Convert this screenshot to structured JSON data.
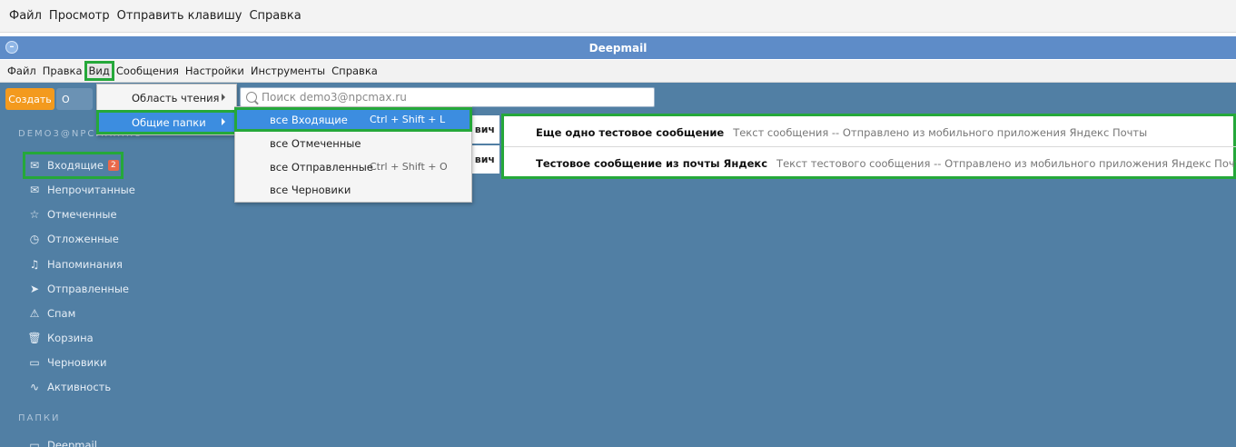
{
  "outer_menu": [
    "Файл",
    "Просмотр",
    "Отправить клавишу",
    "Справка"
  ],
  "window": {
    "title": "Deepmail"
  },
  "app_menu": [
    "Файл",
    "Правка",
    "Вид",
    "Сообщения",
    "Настройки",
    "Инструменты",
    "Справка"
  ],
  "toolbar": {
    "create_label": "Создать",
    "other_label": "О"
  },
  "search": {
    "placeholder": "Поиск demo3@npcmax.ru"
  },
  "account": "DEMO3@NPCMAX.RU",
  "folders": [
    {
      "label": "Входящие",
      "icon": "inbox-icon",
      "badge": "2"
    },
    {
      "label": "Непрочитанные",
      "icon": "unread-icon"
    },
    {
      "label": "Отмеченные",
      "icon": "star-icon"
    },
    {
      "label": "Отложенные",
      "icon": "clock-icon"
    },
    {
      "label": "Напоминания",
      "icon": "bell-icon"
    },
    {
      "label": "Отправленные",
      "icon": "send-icon"
    },
    {
      "label": "Спам",
      "icon": "spam-icon"
    },
    {
      "label": "Корзина",
      "icon": "trash-icon"
    },
    {
      "label": "Черновики",
      "icon": "draft-icon"
    },
    {
      "label": "Активность",
      "icon": "activity-icon"
    }
  ],
  "section_folders": "ПАПКИ",
  "folder_deepmail": "Deepmail",
  "messages": [
    {
      "sender_tail": "вич",
      "subject": "Еще одно тестовое сообщение",
      "preview": "Текст сообщения -- Отправлено из мобильного приложения Яндекс Почты"
    },
    {
      "sender_tail": "вич",
      "subject": "Тестовое сообщение из почты Яндекс",
      "preview": "Текст тестового сообщения -- Отправлено из мобильного приложения Яндекс Почты"
    }
  ],
  "view_menu": [
    "Область чтения",
    "Общие папки"
  ],
  "shared_folders_menu": [
    {
      "label": "все Входящие",
      "shortcut": "Ctrl + Shift + L"
    },
    {
      "label": "все Отмеченные",
      "shortcut": ""
    },
    {
      "label": "все Отправленные",
      "shortcut": "Ctrl + Shift + O"
    },
    {
      "label": "все Черновики",
      "shortcut": ""
    }
  ],
  "colors": {
    "accent": "#3c8de0",
    "highlight": "#25a83a",
    "main_bg": "#517fa4",
    "create_btn": "#f39a1e",
    "badge": "#e9694b"
  }
}
